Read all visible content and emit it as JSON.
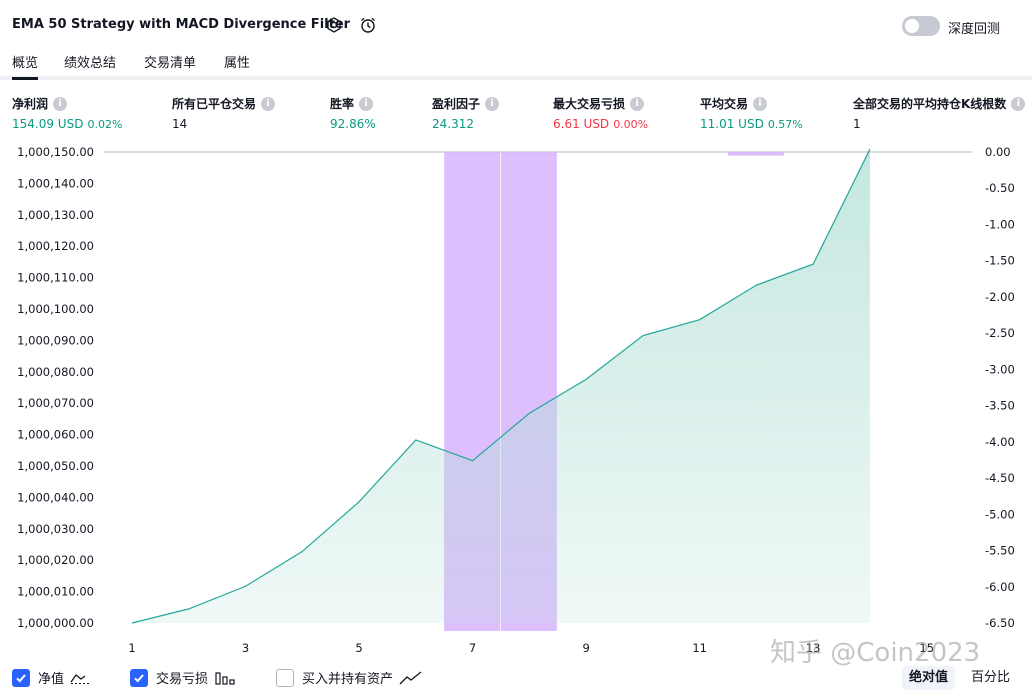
{
  "header": {
    "title": "EMA 50 Strategy with MACD Divergence Filter",
    "settings_icon": "gear-icon",
    "alert_icon": "alarm-clock-icon",
    "deep_backtest_label": "深度回测",
    "deep_backtest_enabled": false
  },
  "tabs": [
    {
      "label": "概览",
      "active": true
    },
    {
      "label": "绩效总结",
      "active": false
    },
    {
      "label": "交易清单",
      "active": false
    },
    {
      "label": "属性",
      "active": false
    }
  ],
  "metrics": [
    {
      "label": "净利润",
      "value": "154.09 USD",
      "pct": "0.02%",
      "color": "green"
    },
    {
      "label": "所有已平仓交易",
      "value": "14",
      "pct": "",
      "color": "dark"
    },
    {
      "label": "胜率",
      "value": "92.86%",
      "pct": "",
      "color": "green"
    },
    {
      "label": "盈利因子",
      "value": "24.312",
      "pct": "",
      "color": "green"
    },
    {
      "label": "最大交易亏损",
      "value": "6.61 USD",
      "pct": "0.00%",
      "color": "red"
    },
    {
      "label": "平均交易",
      "value": "11.01 USD",
      "pct": "0.57%",
      "color": "green"
    },
    {
      "label": "全部交易的平均持仓K线根数",
      "value": "1",
      "pct": "",
      "color": "dark"
    }
  ],
  "colors": {
    "equity_line": "#26a69a",
    "equity_fill": "#b2dfd6",
    "loss_bar": "#d8b4fe",
    "positive": "#089981",
    "negative": "#f23645",
    "checkbox": "#2962ff"
  },
  "chart_data": {
    "type": "area",
    "x": [
      1,
      2,
      3,
      4,
      5,
      6,
      7,
      8,
      9,
      10,
      11,
      12,
      13,
      14
    ],
    "equity": [
      1000000.0,
      1000004.5,
      1000011.7,
      1000022.8,
      1000038.6,
      1000058.3,
      1000051.7,
      1000066.8,
      1000077.6,
      1000091.5,
      1000096.6,
      1000107.6,
      1000114.3,
      1000150.9
    ],
    "trade_loss": [
      0,
      0,
      0,
      0,
      0,
      0,
      -6.61,
      -6.61,
      0,
      0,
      0,
      -0.05,
      0,
      0
    ],
    "x_ticks": [
      "1",
      "3",
      "5",
      "7",
      "9",
      "11",
      "13",
      "15"
    ],
    "y_left_ticks": [
      "1,000,000.00",
      "1,000,010.00",
      "1,000,020.00",
      "1,000,030.00",
      "1,000,040.00",
      "1,000,050.00",
      "1,000,060.00",
      "1,000,070.00",
      "1,000,080.00",
      "1,000,090.00",
      "1,000,100.00",
      "1,000,110.00",
      "1,000,120.00",
      "1,000,130.00",
      "1,000,140.00",
      "1,000,150.00"
    ],
    "y_right_ticks": [
      "0.00",
      "-0.50",
      "-1.00",
      "-1.50",
      "-2.00",
      "-2.50",
      "-3.00",
      "-3.50",
      "-4.00",
      "-4.50",
      "-5.00",
      "-5.50",
      "-6.00",
      "-6.50"
    ],
    "y_left_range": [
      1000000.0,
      1000150.0
    ],
    "y_right_range": [
      -6.5,
      0.0
    ],
    "x_range": [
      1,
      15
    ]
  },
  "legend": {
    "equity_label": "净值",
    "equity_checked": true,
    "equity_icon": "line-chart-icon",
    "drawdown_label": "交易亏损",
    "drawdown_checked": true,
    "drawdown_icon": "bar-chart-icon",
    "buyhold_label": "买入并持有资产",
    "buyhold_checked": false,
    "buyhold_icon": "trend-line-icon",
    "absolute_label": "绝对值",
    "percent_label": "百分比"
  },
  "watermark": "知乎 @Coin2023"
}
